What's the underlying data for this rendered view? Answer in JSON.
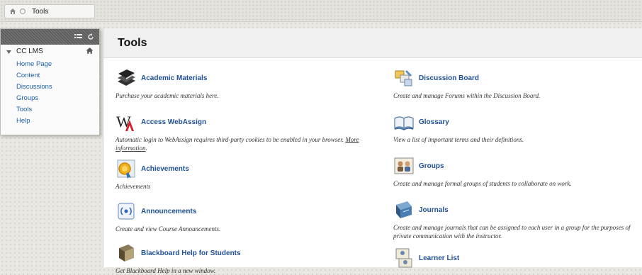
{
  "breadcrumb": {
    "page": "Tools"
  },
  "sidebar": {
    "course": "CC LMS",
    "items": [
      {
        "label": "Home Page"
      },
      {
        "label": "Content"
      },
      {
        "label": "Discussions"
      },
      {
        "label": "Groups"
      },
      {
        "label": "Tools"
      },
      {
        "label": "Help"
      }
    ]
  },
  "main": {
    "title": "Tools",
    "tools": [
      {
        "label": "Academic Materials",
        "desc": "Purchase your academic materials here.",
        "icon": "books-icon"
      },
      {
        "label": "Access WebAssign",
        "desc": "Automatic login to WebAssign requires third-party cookies to be enabled in your browser.",
        "link": "More information",
        "icon": "webassign-logo"
      },
      {
        "label": "Achievements",
        "desc": "Achievements",
        "icon": "medal-icon"
      },
      {
        "label": "Announcements",
        "desc": "Create and view Course Announcements.",
        "icon": "megaphone-icon"
      },
      {
        "label": "Blackboard Help for Students",
        "desc": "Get Blackboard Help in a new window.",
        "icon": "help-book-icon"
      },
      {
        "label": "Discussion Board",
        "desc": "Create and manage Forums within the Discussion Board.",
        "icon": "discussion-board-icon"
      },
      {
        "label": "Glossary",
        "desc": "View a list of important terms and their definitions.",
        "icon": "open-book-icon"
      },
      {
        "label": "Groups",
        "desc": "Create and manage formal groups of students to collaborate on work.",
        "icon": "groups-icon"
      },
      {
        "label": "Journals",
        "desc": "Create and manage journals that can be assigned to each user in a group for the purposes of private communication with the instructor.",
        "icon": "journal-icon"
      },
      {
        "label": "Learner List",
        "desc": "",
        "icon": "learner-list-icon"
      }
    ]
  },
  "colors": {
    "link": "#1f4f96",
    "menu_link": "#1f5fa8",
    "sidebar_head": "#6a6a6a"
  }
}
